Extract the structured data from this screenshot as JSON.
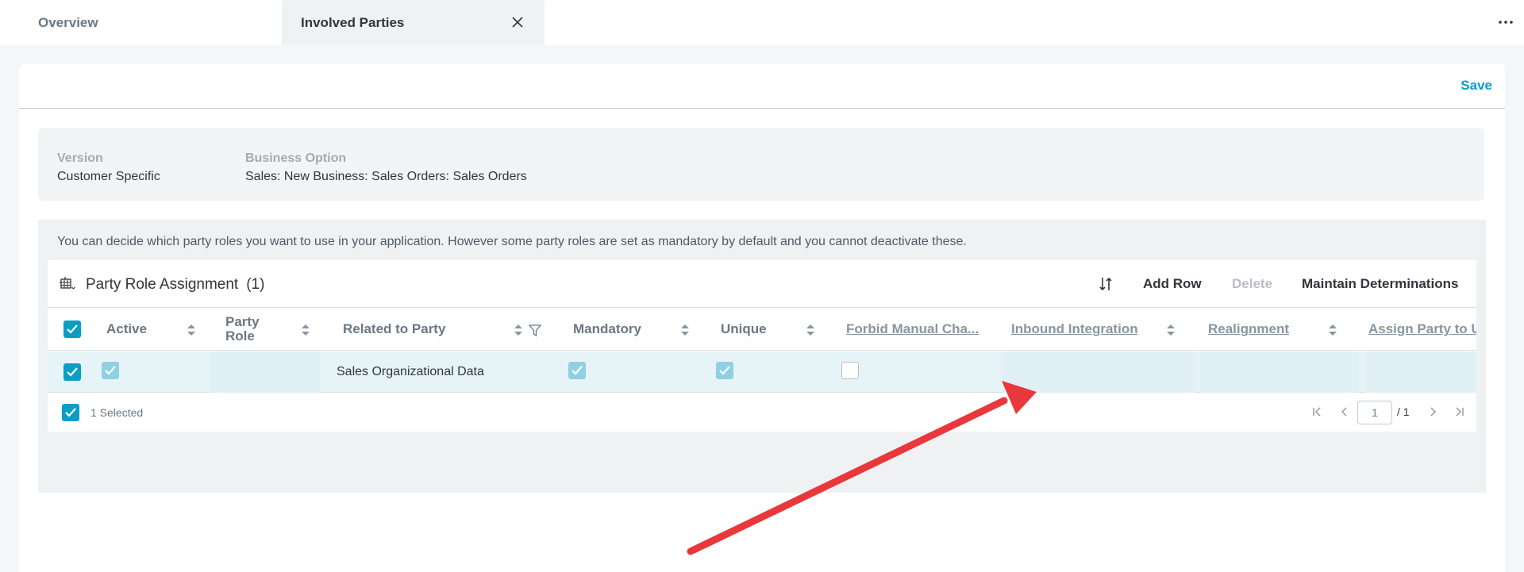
{
  "tabs": {
    "overview": "Overview",
    "active": "Involved Parties"
  },
  "header": {
    "save": "Save"
  },
  "info": {
    "version_label": "Version",
    "version_value": "Customer Specific",
    "option_label": "Business Option",
    "option_value": "Sales: New Business: Sales Orders: Sales Orders"
  },
  "hint": "You can decide which party roles you want to use in your application. However some party roles are set as mandatory by default and you cannot deactivate these.",
  "table": {
    "title": "Party Role Assignment",
    "count": "(1)",
    "actions": {
      "add_row": "Add Row",
      "delete": "Delete",
      "maintain": "Maintain Determinations"
    },
    "columns": {
      "active": "Active",
      "party_role": "Party Role",
      "related": "Related to Party",
      "mandatory": "Mandatory",
      "unique": "Unique",
      "forbid": "Forbid Manual Cha...",
      "inbound": "Inbound Integration",
      "realignment": "Realignment",
      "assign": "Assign Party to U"
    },
    "row": {
      "related": "Sales Organizational Data",
      "active": true,
      "mandatory": true,
      "unique": true,
      "forbid": false
    },
    "footer": {
      "selected": "1 Selected",
      "page": "1",
      "total": "/ 1"
    }
  },
  "colors": {
    "accent": "#0a9ec4",
    "annotation_arrow": "#e8383b"
  }
}
